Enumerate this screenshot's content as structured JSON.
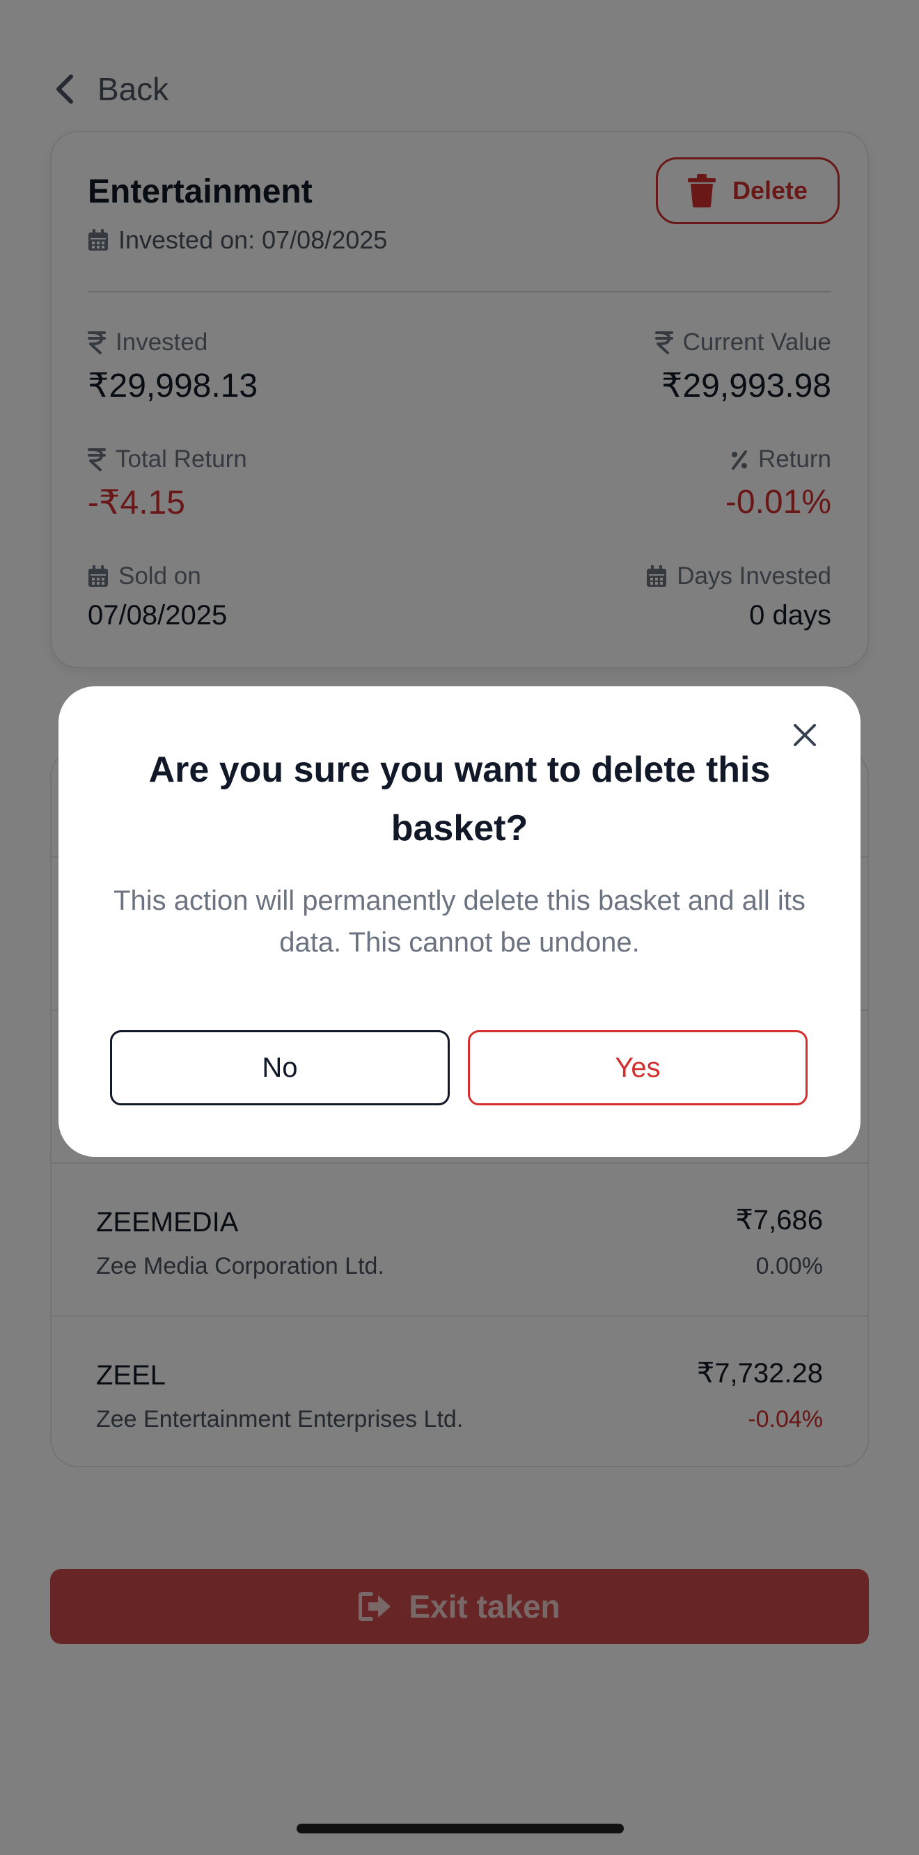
{
  "nav": {
    "back_label": "Back"
  },
  "basket": {
    "name": "Entertainment",
    "invested_on": "Invested on: 07/08/2025",
    "delete_label": "Delete",
    "stats": {
      "invested_label": "Invested",
      "invested_value": "₹29,998.13",
      "current_value_label": "Current Value",
      "current_value": "₹29,993.98",
      "total_return_label": "Total Return",
      "total_return_value": "-₹4.15",
      "return_label": "Return",
      "return_value": "-0.01%",
      "sold_on_label": "Sold on",
      "sold_on_value": "07/08/2025",
      "days_invested_label": "Days Invested",
      "days_invested_value": "0 days"
    }
  },
  "holdings": [
    {
      "symbol": "ZEEMEDIA",
      "name": "Zee Media Corporation Ltd.",
      "amount": "₹7,686",
      "change": "0.00%"
    },
    {
      "symbol": "ZEEL",
      "name": "Zee Entertainment Enterprises Ltd.",
      "amount": "₹7,732.28",
      "change": "-0.04%"
    }
  ],
  "exit": {
    "label": "Exit taken"
  },
  "modal": {
    "title": "Are you sure you want to delete this basket?",
    "description": "This action will permanently delete this basket and all its data. This cannot be undone.",
    "no_label": "No",
    "yes_label": "Yes"
  },
  "colors": {
    "negative": "#d32f2f",
    "overlay": "rgba(0,0,0,0.5)",
    "exit_button": "#d04b4b"
  }
}
